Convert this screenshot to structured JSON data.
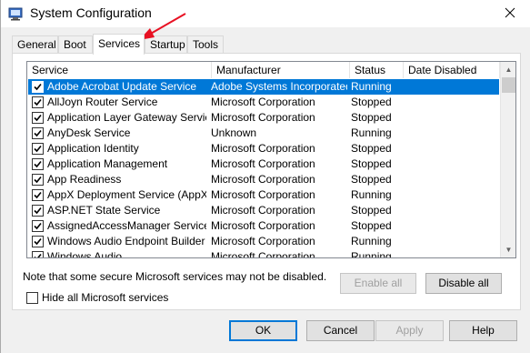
{
  "window": {
    "title": "System Configuration"
  },
  "tabs": [
    {
      "label": "General"
    },
    {
      "label": "Boot"
    },
    {
      "label": "Services"
    },
    {
      "label": "Startup"
    },
    {
      "label": "Tools"
    }
  ],
  "list": {
    "columns": [
      "Service",
      "Manufacturer",
      "Status",
      "Date Disabled"
    ],
    "rows": [
      {
        "service": "Adobe Acrobat Update Service",
        "manufacturer": "Adobe Systems Incorporated",
        "status": "Running",
        "checked": true,
        "selected": true
      },
      {
        "service": "AllJoyn Router Service",
        "manufacturer": "Microsoft Corporation",
        "status": "Stopped",
        "checked": true
      },
      {
        "service": "Application Layer Gateway Service",
        "manufacturer": "Microsoft Corporation",
        "status": "Stopped",
        "checked": true
      },
      {
        "service": "AnyDesk Service",
        "manufacturer": "Unknown",
        "status": "Running",
        "checked": true
      },
      {
        "service": "Application Identity",
        "manufacturer": "Microsoft Corporation",
        "status": "Stopped",
        "checked": true
      },
      {
        "service": "Application Management",
        "manufacturer": "Microsoft Corporation",
        "status": "Stopped",
        "checked": true
      },
      {
        "service": "App Readiness",
        "manufacturer": "Microsoft Corporation",
        "status": "Stopped",
        "checked": true
      },
      {
        "service": "AppX Deployment Service (AppX...",
        "manufacturer": "Microsoft Corporation",
        "status": "Running",
        "checked": true
      },
      {
        "service": "ASP.NET State Service",
        "manufacturer": "Microsoft Corporation",
        "status": "Stopped",
        "checked": true
      },
      {
        "service": "AssignedAccessManager Service",
        "manufacturer": "Microsoft Corporation",
        "status": "Stopped",
        "checked": true
      },
      {
        "service": "Windows Audio Endpoint Builder",
        "manufacturer": "Microsoft Corporation",
        "status": "Running",
        "checked": true
      },
      {
        "service": "Windows Audio",
        "manufacturer": "Microsoft Corporation",
        "status": "Running",
        "checked": true
      }
    ]
  },
  "note": "Note that some secure Microsoft services may not be disabled.",
  "buttons": {
    "enable_all": "Enable all",
    "disable_all": "Disable all",
    "ok": "OK",
    "cancel": "Cancel",
    "apply": "Apply",
    "help": "Help"
  },
  "hide_ms": {
    "label": "Hide all Microsoft services",
    "checked": false
  },
  "icons": {
    "app": "system-configuration-icon",
    "close": "close-icon",
    "annotation": "red-arrow-icon"
  },
  "colors": {
    "selection": "#0078d7",
    "annotation": "#e81123"
  }
}
